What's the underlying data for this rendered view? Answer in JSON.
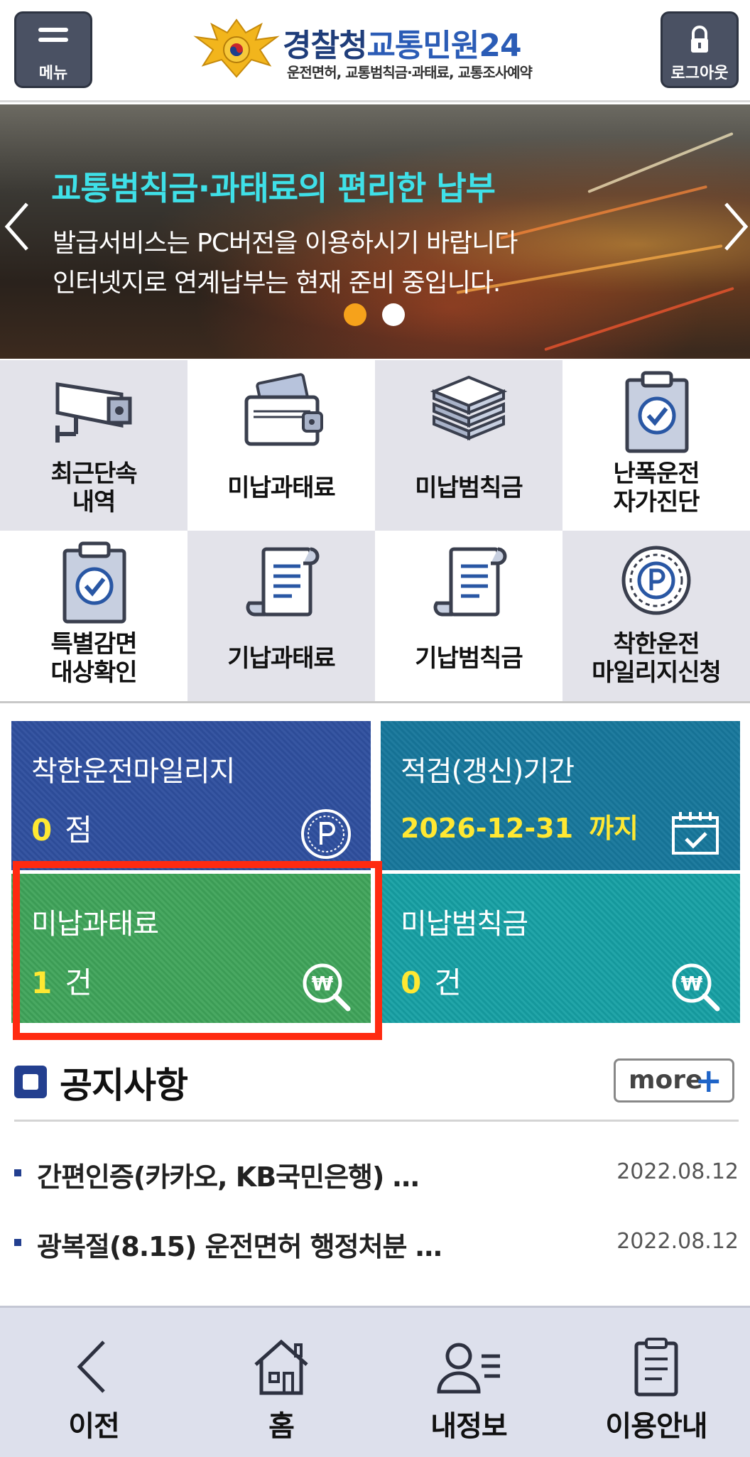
{
  "header": {
    "menu_label": "메뉴",
    "logout_label": "로그아웃",
    "title_part1": "경찰청",
    "title_part2": "교통민원24",
    "subtitle": "운전면허, 교통범칙금·과태료, 교통조사예약",
    "emblem_icon": "police-emblem-icon"
  },
  "banner": {
    "title": "교통범칙금·과태료의 편리한 납부",
    "line1": "발급서비스는 PC버전을 이용하시기 바랍니다",
    "line2": "인터넷지로 연계납부는 현재 준비 중입니다.",
    "slide_count": 2,
    "active_slide": 1,
    "title_color": "#3fe0e8",
    "active_dot_color": "#f6a21b"
  },
  "menu": {
    "items": [
      {
        "line1": "최근단속",
        "line2": "내역",
        "icon": "cctv-camera-icon"
      },
      {
        "line1": "미납과태료",
        "line2": "",
        "icon": "wallet-icon"
      },
      {
        "line1": "미납범칙금",
        "line2": "",
        "icon": "money-stack-icon"
      },
      {
        "line1": "난폭운전",
        "line2": "자가진단",
        "icon": "clipboard-check-icon"
      },
      {
        "line1": "특별감면",
        "line2": "대상확인",
        "icon": "clipboard-check-icon"
      },
      {
        "line1": "기납과태료",
        "line2": "",
        "icon": "receipt-scroll-icon"
      },
      {
        "line1": "기납범칙금",
        "line2": "",
        "icon": "receipt-scroll-icon"
      },
      {
        "line1": "착한운전",
        "line2": "마일리지신청",
        "icon": "mileage-point-icon"
      }
    ]
  },
  "tiles": {
    "mileage": {
      "label": "착한운전마일리지",
      "value": "0",
      "unit": "점",
      "icon": "point-coin-icon",
      "color": "#2f4f9e"
    },
    "renewal": {
      "label": "적검(갱신)기간",
      "value": "2026-12-31",
      "unit": "까지",
      "icon": "calendar-check-icon",
      "color": "#17779b"
    },
    "unpaid_fine": {
      "label": "미납과태료",
      "value": "1",
      "unit": "건",
      "icon": "won-search-icon",
      "color": "#3fa45a"
    },
    "unpaid_penalty": {
      "label": "미납범칙금",
      "value": "0",
      "unit": "건",
      "icon": "won-search-icon",
      "color": "#16a0a4"
    }
  },
  "notices": {
    "title": "공지사항",
    "more_label": "more",
    "items": [
      {
        "text": "간편인증(카카오, KB국민은행) …",
        "date": "2022.08.12"
      },
      {
        "text": "광복절(8.15) 운전면허 행정처분 …",
        "date": "2022.08.12"
      }
    ]
  },
  "bottom_nav": {
    "items": [
      {
        "label": "이전",
        "icon": "back-chevron-icon"
      },
      {
        "label": "홈",
        "icon": "home-icon"
      },
      {
        "label": "내정보",
        "icon": "user-list-icon"
      },
      {
        "label": "이용안내",
        "icon": "clipboard-guide-icon"
      }
    ]
  },
  "colors": {
    "highlight": "#ff2a10",
    "accent_yellow": "#ffe832",
    "navy": "#233f8f"
  }
}
